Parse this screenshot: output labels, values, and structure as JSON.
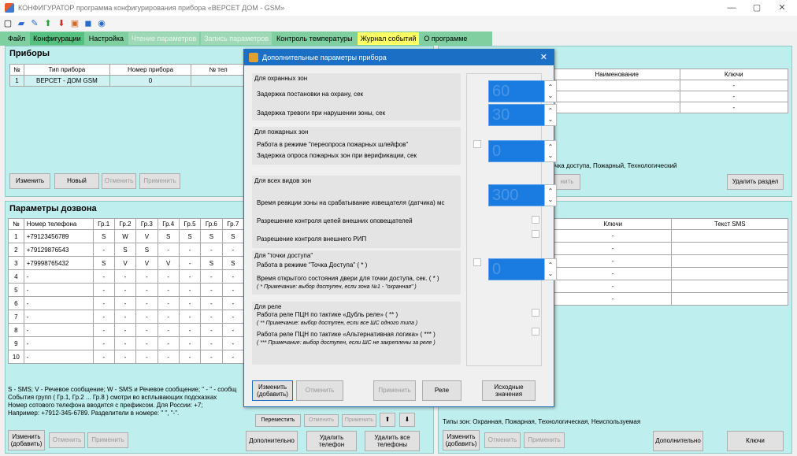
{
  "window": {
    "title": "КОНФИГУРАТОР программа конфигурирования прибора «ВЕРСЕТ ДОМ - GSM»"
  },
  "menu": [
    {
      "label": "Файл",
      "style": "plain"
    },
    {
      "label": "Конфигурации",
      "style": "active"
    },
    {
      "label": "Настройка",
      "style": "plain"
    },
    {
      "label": "Чтение параметров",
      "style": "dim"
    },
    {
      "label": "Запись параметров",
      "style": "dim"
    },
    {
      "label": "Контроль температуры",
      "style": "plain"
    },
    {
      "label": "Журнал событий",
      "style": "yellow"
    },
    {
      "label": "О программе",
      "style": "plain"
    }
  ],
  "devices": {
    "title": "Приборы",
    "headers": [
      "№",
      "Тип прибора",
      "Номер прибора",
      "№ тел"
    ],
    "rows": [
      [
        "1",
        "ВЕРСЕТ - ДОМ GSM",
        "0",
        ""
      ]
    ],
    "buttons": {
      "edit": "Изменить",
      "new": "Новый",
      "cancel": "Отменить",
      "apply": "Применить"
    }
  },
  "right_top": {
    "headers": [
      "Наименование",
      "Ключи"
    ],
    "rows": [
      [
        "",
        "-"
      ],
      [
        "",
        "-"
      ],
      [
        "",
        "-"
      ]
    ],
    "types_note": "- Точка доступа, Пожарный, Технологический",
    "apply_fragment": "нить",
    "delete_section": "Удалить раздел"
  },
  "dial": {
    "title": "Параметры дозвона",
    "headers": [
      "№",
      "Номер телефона",
      "Гр.1",
      "Гр.2",
      "Гр.3",
      "Гр.4",
      "Гр.5",
      "Гр.6",
      "Гр.7"
    ],
    "rows": [
      [
        "1",
        "+79123456789",
        "S",
        "W",
        "V",
        "S",
        "S",
        "S",
        "S"
      ],
      [
        "2",
        "+79129876543",
        "-",
        "S",
        "S",
        "-",
        "-",
        "-",
        "-"
      ],
      [
        "3",
        "+79998765432",
        "S",
        "V",
        "V",
        "V",
        "-",
        "S",
        "S"
      ],
      [
        "4",
        "-",
        "-",
        "-",
        "-",
        "-",
        "-",
        "-",
        "-"
      ],
      [
        "5",
        "-",
        "-",
        "-",
        "-",
        "-",
        "-",
        "-",
        "-"
      ],
      [
        "6",
        "-",
        "-",
        "-",
        "-",
        "-",
        "-",
        "-",
        "-"
      ],
      [
        "7",
        "-",
        "-",
        "-",
        "-",
        "-",
        "-",
        "-",
        "-"
      ],
      [
        "8",
        "-",
        "-",
        "-",
        "-",
        "-",
        "-",
        "-",
        "-"
      ],
      [
        "9",
        "-",
        "-",
        "-",
        "-",
        "-",
        "-",
        "-",
        "-"
      ],
      [
        "10",
        "-",
        "-",
        "-",
        "-",
        "-",
        "-",
        "-",
        "-"
      ]
    ],
    "notes": [
      "S - SMS;  V - Речевое сообщение;  W - SMS и Речевое сообщение; \" - \" - сообщ",
      "События групп ( Гр.1, Гр.2 ... Гр.8 ) смотри во всплывающих подсказках",
      "Номер сотового телефона вводится с префиксом. Для России: +7;",
      "Например: +7912-345-6789. Разделители в номере: \" \", \"-\"."
    ],
    "buttons": {
      "edit": "Изменить (добавить)",
      "cancel": "Отменить",
      "apply": "Применить",
      "move": "Переместить",
      "cancel2": "Отменить",
      "apply2": "Применить",
      "more": "Дополнительно",
      "delete_phone": "Удалить телефон",
      "delete_all": "Удалить все телефоны"
    }
  },
  "sms": {
    "headers": [
      "Ключи",
      "Текст SMS"
    ],
    "rows": [
      [
        "-",
        ""
      ],
      [
        "-",
        ""
      ],
      [
        "-",
        ""
      ],
      [
        "-",
        ""
      ],
      [
        "-",
        ""
      ],
      [
        "-",
        ""
      ]
    ],
    "zone_types": "Типы зон: Охранная, Пожарная, Технологическая, Неиспользуемая",
    "buttons": {
      "edit": "Изменить (добавить)",
      "cancel": "Отменить",
      "apply": "Применить",
      "more": "Дополнительно",
      "keys": "Ключи"
    }
  },
  "dialog": {
    "title": "Дополнительные параметры прибора",
    "security": {
      "title": "Для охранных зон",
      "arm_delay": "Задержка постановки на охрану, сек",
      "alarm_delay": "Задержка тревоги при нарушении зоны, сек",
      "arm_value": "60",
      "alarm_value": "30"
    },
    "fire": {
      "title": "Для пожарных зон",
      "requery": "Работа в режиме  \"переопроса пожарных шлейфов\"",
      "delay": "Задержка опроса пожарных зон при верификации, сек",
      "value": "0"
    },
    "all": {
      "title": "Для всех видов зон",
      "reaction": "Время реакции зоны на срабатывание извещателя (датчика) мс",
      "ext_notifiers": "Разрешение контроля цепей внешних оповещателей",
      "ext_rip": "Разрешение контроля внешнего РИП",
      "value": "300"
    },
    "access": {
      "title": "Для \"точки доступа\"",
      "mode": "Работа в режиме  \"Точка Доступа\"  ( * )",
      "open_time": "Время открытого состояния двери для точки доступа, сек. ( * )",
      "note": "( * Примечание: выбор доступен, если зона №1 - \"охранная\" )",
      "value": "0"
    },
    "relay": {
      "title": "Для реле",
      "dub": "Работа реле ПЦН по тактике «Дубль реле»  ( ** )",
      "dub_note": "( ** Примечание: выбор доступен, если все ШС одного типа )",
      "alt": "Работа реле ПЦН по тактике «Альтернативная логика»  ( *** )",
      "alt_note": "( *** Примечание: выбор доступен, если ШС не закреплены за реле )"
    },
    "buttons": {
      "edit": "Изменить (добавить)",
      "cancel": "Отменить",
      "apply": "Применить",
      "relay": "Реле",
      "defaults": "Исходные значения"
    }
  }
}
